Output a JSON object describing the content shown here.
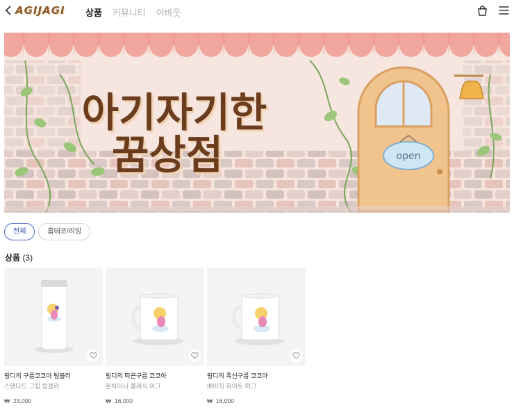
{
  "header": {
    "back_icon": "chevron-left-icon",
    "logo": "AGIJAGI",
    "nav": [
      {
        "label": "상품",
        "active": true
      },
      {
        "label": "커뮤니티",
        "active": false
      },
      {
        "label": "어바웃",
        "active": false
      }
    ],
    "icons": [
      "shopping-bag-icon",
      "menu-icon"
    ]
  },
  "banner": {
    "title_line1": "아기자기한",
    "title_line2": "꿈상점",
    "sign": "open"
  },
  "filters": [
    {
      "label": "전체",
      "active": true
    },
    {
      "label": "홈데코/리빙",
      "active": false
    }
  ],
  "section": {
    "title": "상품",
    "count": "(3)"
  },
  "currency": "₩",
  "products": [
    {
      "name": "링디의 구름코코아 텀블러",
      "sub": "스탠다드 그립 텀블러",
      "price": "23,000",
      "type": "tumbler"
    },
    {
      "name": "링디의 따끈구름 코코아",
      "sub": "본차이나 클래식 머그",
      "price": "16,000",
      "type": "mug"
    },
    {
      "name": "링디의 폭신구름 코코아",
      "sub": "베이직 화이트 머그",
      "price": "16,000",
      "type": "mug"
    }
  ],
  "colors": {
    "accent": "#4b63c6",
    "logo": "#8b5a2b",
    "awning": "#f0a39a",
    "title_brown": "#6b3d1e",
    "door": "#f2c48d"
  }
}
